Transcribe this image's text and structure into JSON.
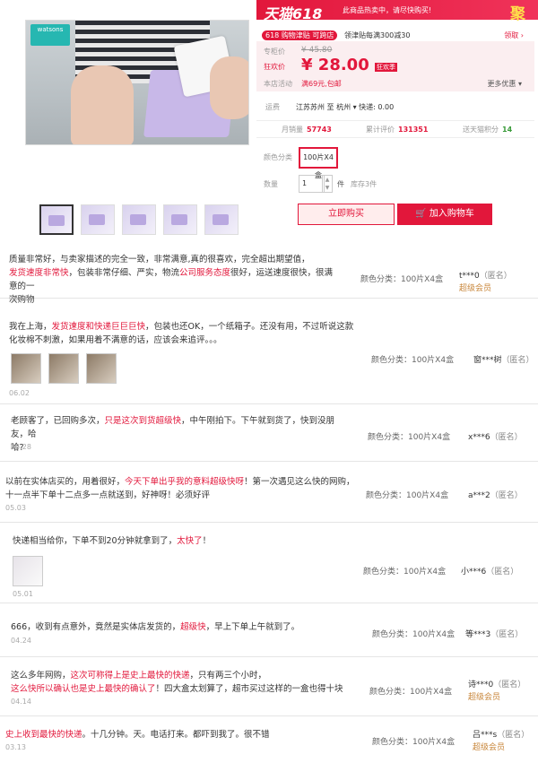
{
  "product": {
    "brand_badge": "watsons",
    "thumbnails": [
      "thumb-1",
      "thumb-2",
      "thumb-3",
      "thumb-4",
      "thumb-5"
    ]
  },
  "banner": {
    "logo": "天猫618",
    "tip": "此商品热卖中，请尽快购买!",
    "ju": "聚"
  },
  "coupon": {
    "tag": "618 购物津贴 可跨店",
    "text": "领津贴每满300减30",
    "get": "领取 ›"
  },
  "price": {
    "orig_label": "专柜价",
    "orig_value": "¥ 45.80",
    "promo_label": "狂欢价",
    "promo_value": "¥ 28.00",
    "promo_badge": "狂欢季",
    "activity_label": "本店活动",
    "activity_text": "满69元,包邮",
    "more": "更多优惠 ▾"
  },
  "shipping": {
    "label": "运费",
    "text": "江苏苏州 至 杭州 ▾ 快递: 0.00"
  },
  "stats": {
    "monthly_label": "月销量",
    "monthly_value": "57743",
    "total_label": "累计评价",
    "total_value": "131351",
    "points_label": "送天猫积分",
    "points_value": "14"
  },
  "options": {
    "color_label": "颜色分类",
    "color_value": "100片X4盒",
    "qty_label": "数量",
    "qty_value": "1",
    "qty_unit": "件",
    "stock": "库存3件"
  },
  "actions": {
    "buy_now": "立即购买",
    "add_cart": "加入购物车"
  },
  "reviews": [
    {
      "line1": "质量非常好，与卖家描述的完全一致，非常满意,真的很喜欢，完全超出期望值，",
      "line2_hl": "发货速度非常快",
      "line2_a": "，包装非常仔细、严实，物流",
      "line2_hl2": "公司服务态度",
      "line2_b": "很好，运送速度很快，很满意的一",
      "line3": "次购物",
      "date": "06.03",
      "spec": "颜色分类：100片X4盒",
      "user": "t***0",
      "anon": "（匿名）",
      "vip": "超级会员"
    },
    {
      "line1_a": "我在上海，",
      "line1_hl": "发货速度和快递巨巨巨快",
      "line1_b": "，包装也还OK，一个纸箱子。还没有用，不过听说这款",
      "line2": "化妆棉不刺激，如果用着不满意的话，应该会来追评。。。",
      "date": "06.02",
      "spec": "颜色分类：100片X4盒",
      "user": "窗***树",
      "anon": "（匿名）"
    },
    {
      "line1_a": "老顾客了，已回购多次，",
      "line1_hl": "只是这次到货超级快",
      "line1_b": "，中午刚拍下。下午就到货了，快到没朋友，哈",
      "line2": "哈?",
      "date": "05.28",
      "spec": "颜色分类：100片X4盒",
      "user": "x***6",
      "anon": "（匿名）"
    },
    {
      "line1_a": "以前在实体店买的，用着很好，",
      "line1_hl": "今天下单出乎我的意料超级快呀",
      "line1_b": "！第一次遇见这么快的网购，",
      "line2": "十一点半下单十二点多一点就送到，好神呀！必须好评",
      "date": "05.03",
      "spec": "颜色分类：100片X4盒",
      "user": "a***2",
      "anon": "（匿名）"
    },
    {
      "line1_a": "快递相当给你，下单不到20分钟就拿到了，",
      "line1_hl": "太快了",
      "line1_b": "！",
      "date": "05.01",
      "spec": "颜色分类：100片X4盒",
      "user": "小***6",
      "anon": "（匿名）"
    },
    {
      "line1_a": "666，收到有点意外，竟然是实体店发货的，",
      "line1_hl": "超级快",
      "line1_b": "，早上下单上午就到了。",
      "date": "04.24",
      "spec": "颜色分类：100片X4盒",
      "user": "等***3",
      "anon": "（匿名）"
    },
    {
      "line1_a": "这么多年网购，",
      "line1_hl": "这次可称得上是史上最快的快递",
      "line1_b": "，只有两三个小时，",
      "line2_hl": "这么快所以确认也是史上最快的确认了",
      "line2_b": "！四大盒太划算了，超市买过这样的一盒也得十块",
      "date": "04.14",
      "spec": "颜色分类：100片X4盒",
      "user": "诗***0",
      "anon": "（匿名）",
      "vip": "超级会员"
    },
    {
      "line1_hl": "史上收到最快的快递",
      "line1_b": "。十几分钟。天。电话打来。都吓到我了。很不错",
      "date": "03.13",
      "spec": "颜色分类：100片X4盒",
      "user": "吕***s",
      "anon": "（匿名）",
      "vip": "超级会员"
    }
  ]
}
